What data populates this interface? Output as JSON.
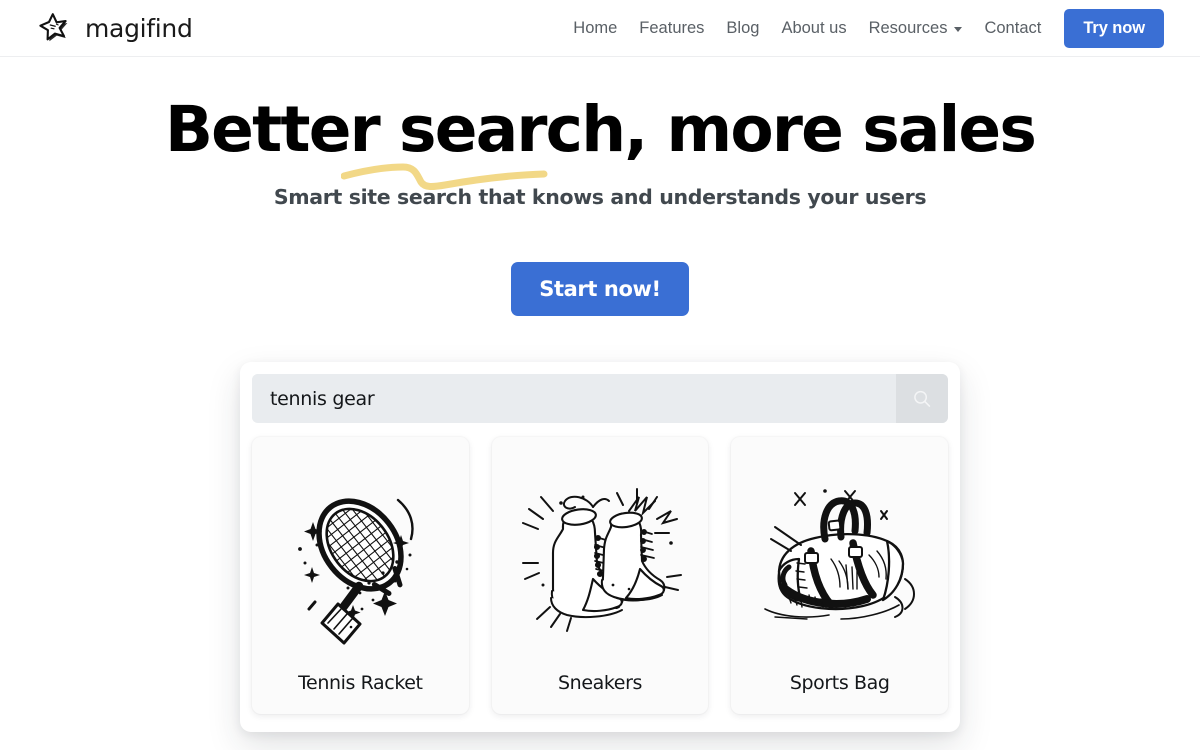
{
  "brand": {
    "name": "magifind",
    "logo_icon": "hand-drawn-star-icon"
  },
  "nav": {
    "items": [
      {
        "label": "Home"
      },
      {
        "label": "Features"
      },
      {
        "label": "Blog"
      },
      {
        "label": "About us"
      }
    ],
    "dropdown": {
      "label": "Resources",
      "icon": "chevron-down-icon"
    },
    "contact": {
      "label": "Contact"
    },
    "cta": {
      "label": "Try now"
    }
  },
  "hero": {
    "title": "Better search, more sales",
    "underline_accent_color": "#f2d887",
    "subtitle": "Smart site search that knows and understands your users",
    "cta_label": "Start now!"
  },
  "demo": {
    "search": {
      "value": "tennis gear",
      "placeholder": "Search products...",
      "button_icon": "search-icon"
    },
    "results": [
      {
        "label": "Tennis Racket",
        "art": "tennis-racket-illustration"
      },
      {
        "label": "Sneakers",
        "art": "sneakers-illustration"
      },
      {
        "label": "Sports Bag",
        "art": "sports-bag-illustration"
      }
    ]
  },
  "colors": {
    "accent_blue": "#3a6fd4",
    "accent_yellow": "#f2d887",
    "text_dark": "#14171a",
    "text_muted": "#5a6066",
    "search_bg": "#e9ecef",
    "search_btn_bg": "#dcdfe2",
    "card_bg": "#fbfbfb"
  }
}
